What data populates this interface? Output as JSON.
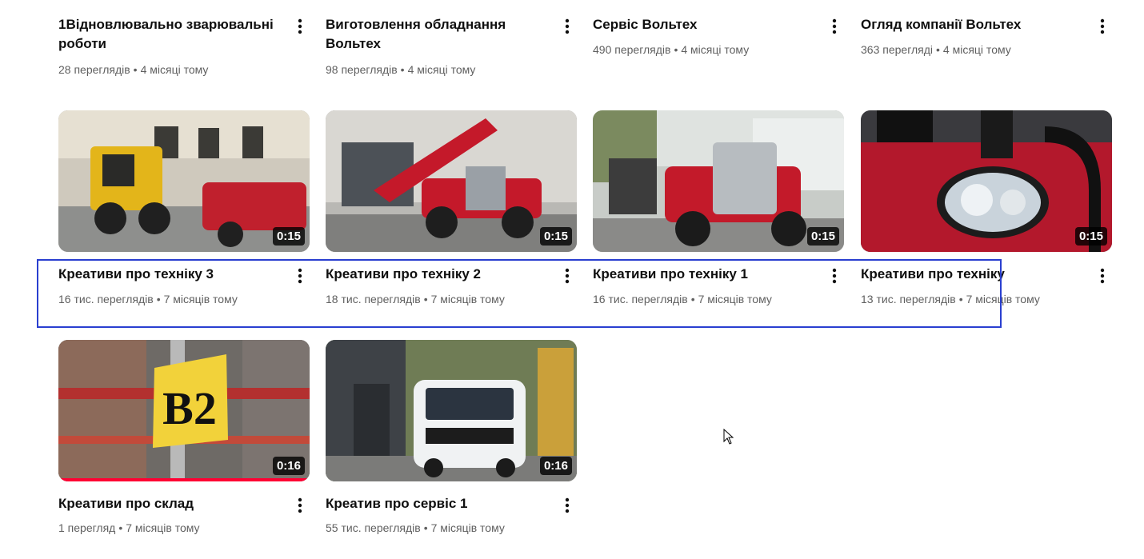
{
  "top_row": [
    {
      "title": "1Відновлювально зварювальні роботи",
      "views": "28 переглядів",
      "age": "4 місяці тому"
    },
    {
      "title": "Виготовлення обладнання Вольтех",
      "views": "98 переглядів",
      "age": "4 місяці тому"
    },
    {
      "title": "Сервіс Вольтех",
      "views": "490 переглядів",
      "age": "4 місяці тому"
    },
    {
      "title": "Огляд компанії Вольтех",
      "views": "363 переглядi",
      "age": "4 місяці тому"
    }
  ],
  "middle_row": [
    {
      "title": "Креативи про техніку 3",
      "views": "16 тис. переглядів",
      "age": "7 місяців тому",
      "duration": "0:15",
      "thumb_icon": "skid-steer-loader-thumbnail"
    },
    {
      "title": "Креативи про техніку 2",
      "views": "18 тис. переглядів",
      "age": "7 місяців тому",
      "duration": "0:15",
      "thumb_icon": "telehandler-thumbnail"
    },
    {
      "title": "Креативи про техніку 1",
      "views": "16 тис. переглядів",
      "age": "7 місяців тому",
      "duration": "0:15",
      "thumb_icon": "telehandler-driver-thumbnail"
    },
    {
      "title": "Креативи про техніку",
      "views": "13 тис. переглядів",
      "age": "7 місяців тому",
      "duration": "0:15",
      "thumb_icon": "headlight-closeup-thumbnail"
    }
  ],
  "bottom_row": [
    {
      "title": "Креативи про склад",
      "views": "1 перегляд",
      "age": "7 місяців тому",
      "duration": "0:16",
      "watched_fraction": 1.0,
      "thumb_icon": "warehouse-b2-sign-thumbnail",
      "thumb_text": "B2"
    },
    {
      "title": "Креатив про сервіс 1",
      "views": "55 тис. переглядів",
      "age": "7 місяців тому",
      "duration": "0:16",
      "thumb_icon": "service-van-thumbnail"
    }
  ],
  "colors": {
    "selection": "#2a3fd0",
    "progress": "#ff0033",
    "meta_text": "#606060"
  }
}
